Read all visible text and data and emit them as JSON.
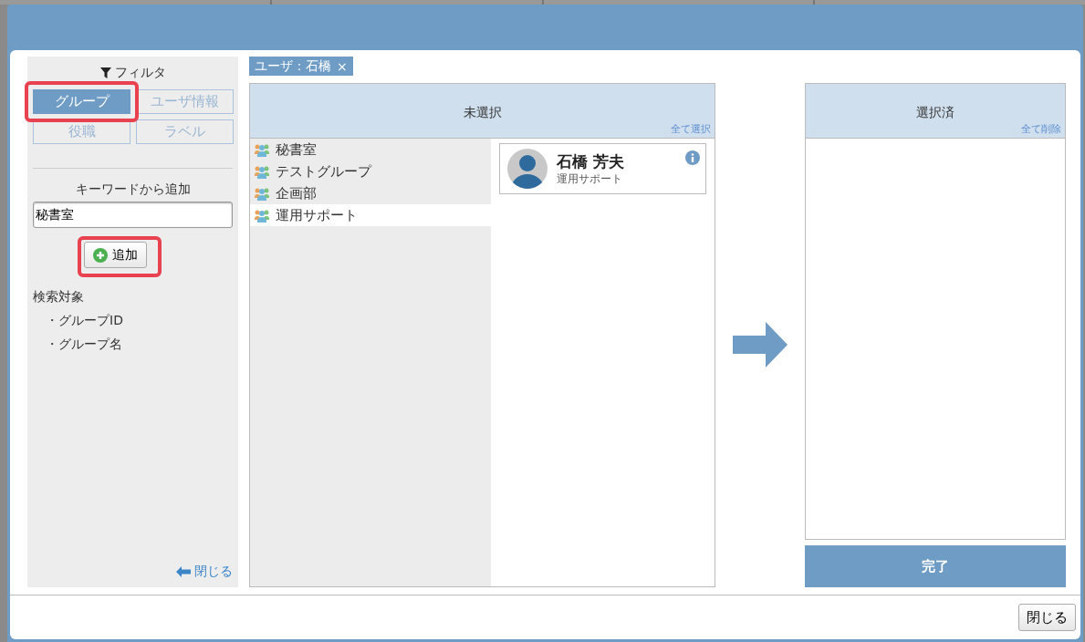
{
  "filter": {
    "title": "フィルタ",
    "tabs": [
      {
        "label": "グループ",
        "selected": true,
        "highlighted": true
      },
      {
        "label": "ユーザ情報",
        "selected": false,
        "highlighted": false
      },
      {
        "label": "役職",
        "selected": false,
        "highlighted": false
      },
      {
        "label": "ラベル",
        "selected": false,
        "highlighted": false
      }
    ],
    "keyword_label": "キーワードから追加",
    "keyword": {
      "value": "秘書室"
    },
    "add_button": {
      "label": "追加",
      "highlighted": true
    },
    "search_target_label": "検索対象",
    "search_targets": [
      "・グループID",
      "・グループ名"
    ],
    "close_link": "閉じる"
  },
  "tag": {
    "label": "ユーザ：石橋",
    "remove": "×"
  },
  "unselected": {
    "title": "未選択",
    "action": "全て選択",
    "groups": [
      {
        "name": "秘書室",
        "selected": false
      },
      {
        "name": "テストグループ",
        "selected": false
      },
      {
        "name": "企画部",
        "selected": false
      },
      {
        "name": "運用サポート",
        "selected": true
      }
    ],
    "users": [
      {
        "name": "石橋 芳夫",
        "group": "運用サポート"
      }
    ]
  },
  "selected_panel": {
    "title": "選択済",
    "action": "全て削除"
  },
  "done_button": "完了",
  "footer": {
    "close_button": "閉じる"
  }
}
